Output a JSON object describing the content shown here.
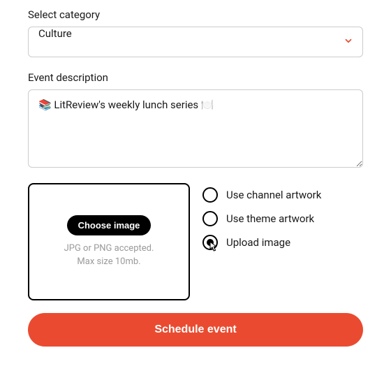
{
  "category": {
    "label": "Select category",
    "selected": "Culture"
  },
  "description": {
    "label": "Event description",
    "value": "📚 LitReview's weekly lunch series 🍽️"
  },
  "imageUpload": {
    "chooseLabel": "Choose image",
    "hintLine1": "JPG or PNG accepted.",
    "hintLine2": "Max size 10mb."
  },
  "artworkOptions": {
    "channel": "Use channel artwork",
    "theme": "Use theme artwork",
    "upload": "Upload image",
    "selected": "upload"
  },
  "submit": {
    "label": "Schedule event"
  },
  "colors": {
    "accent": "#ea4b30"
  }
}
